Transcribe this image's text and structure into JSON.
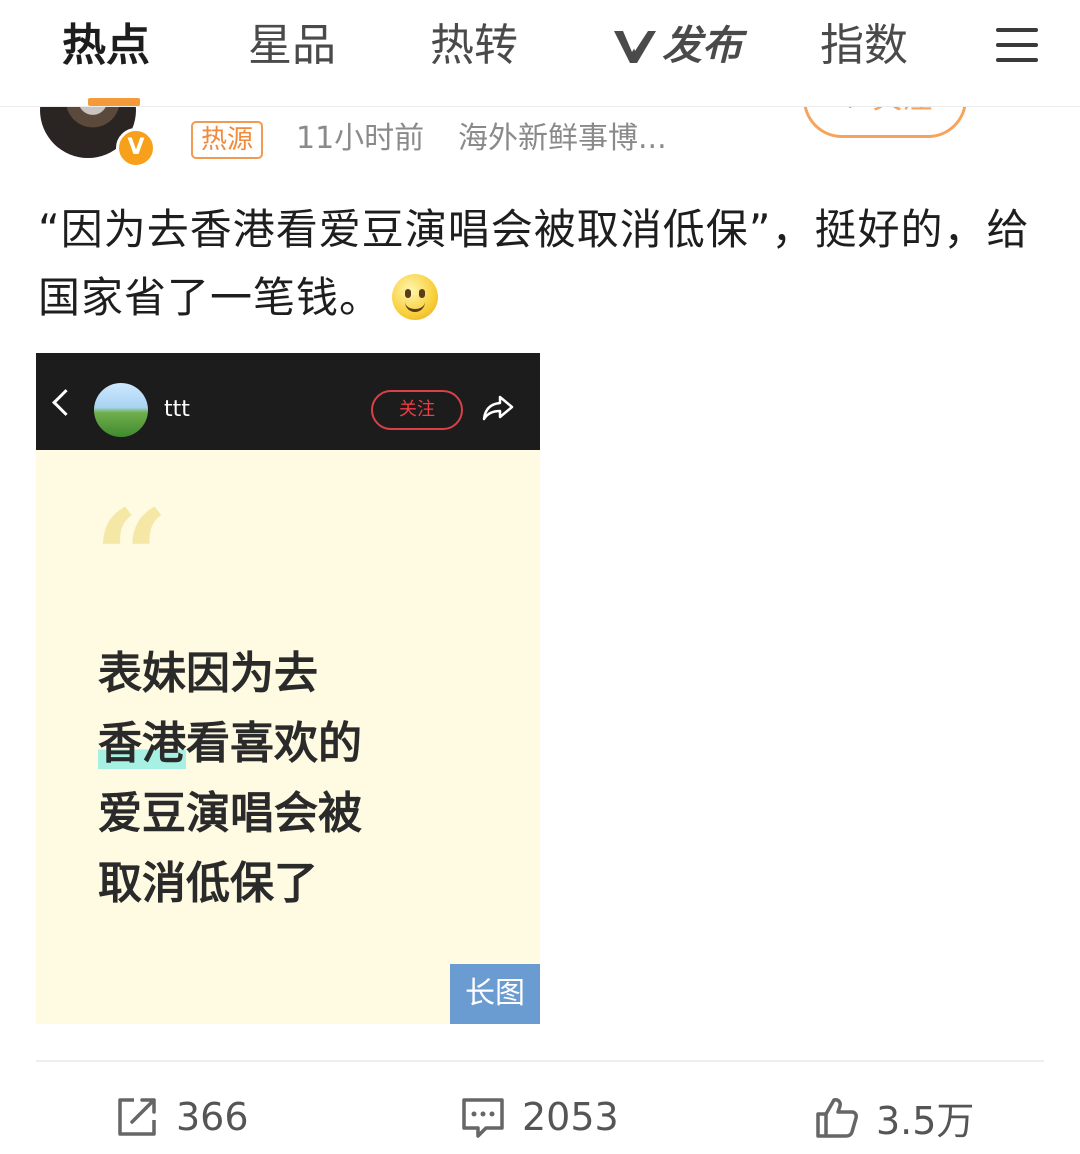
{
  "nav": {
    "tabs": [
      {
        "label": "热点",
        "active": true
      },
      {
        "label": "星品",
        "active": false
      },
      {
        "label": "热转",
        "active": false
      },
      {
        "label": "发布",
        "active": false,
        "icon": "v-logo-icon"
      },
      {
        "label": "指数",
        "active": false
      }
    ],
    "menu_icon": "menu-icon"
  },
  "author": {
    "badge": "V",
    "tag": "热源",
    "time": "11小时前",
    "source": "海外新鲜事博...",
    "follow_label": "+ 关注"
  },
  "post": {
    "text": "“因为去香港看爱豆演唱会被取消低保”，挺好的，给国家省了一笔钱。",
    "emoji": "smiley-icon"
  },
  "embed": {
    "user_name": "ttt",
    "follow_label": "关注",
    "lines": [
      {
        "plain": "表妹因为去"
      },
      {
        "highlight": "香港",
        "plain": "看喜欢的"
      },
      {
        "plain": "爱豆演唱会被"
      },
      {
        "plain": "取消低保了"
      }
    ],
    "long_image_tag": "长图"
  },
  "actions": {
    "shares": "366",
    "comments": "2053",
    "likes": "3.5万"
  },
  "colors": {
    "accent_orange": "#f7a35c",
    "embed_bg": "#fefbe2",
    "embed_bar": "#1c1c1c",
    "follow_red": "#ef3c46",
    "long_tag_blue": "#6a9bd1"
  }
}
